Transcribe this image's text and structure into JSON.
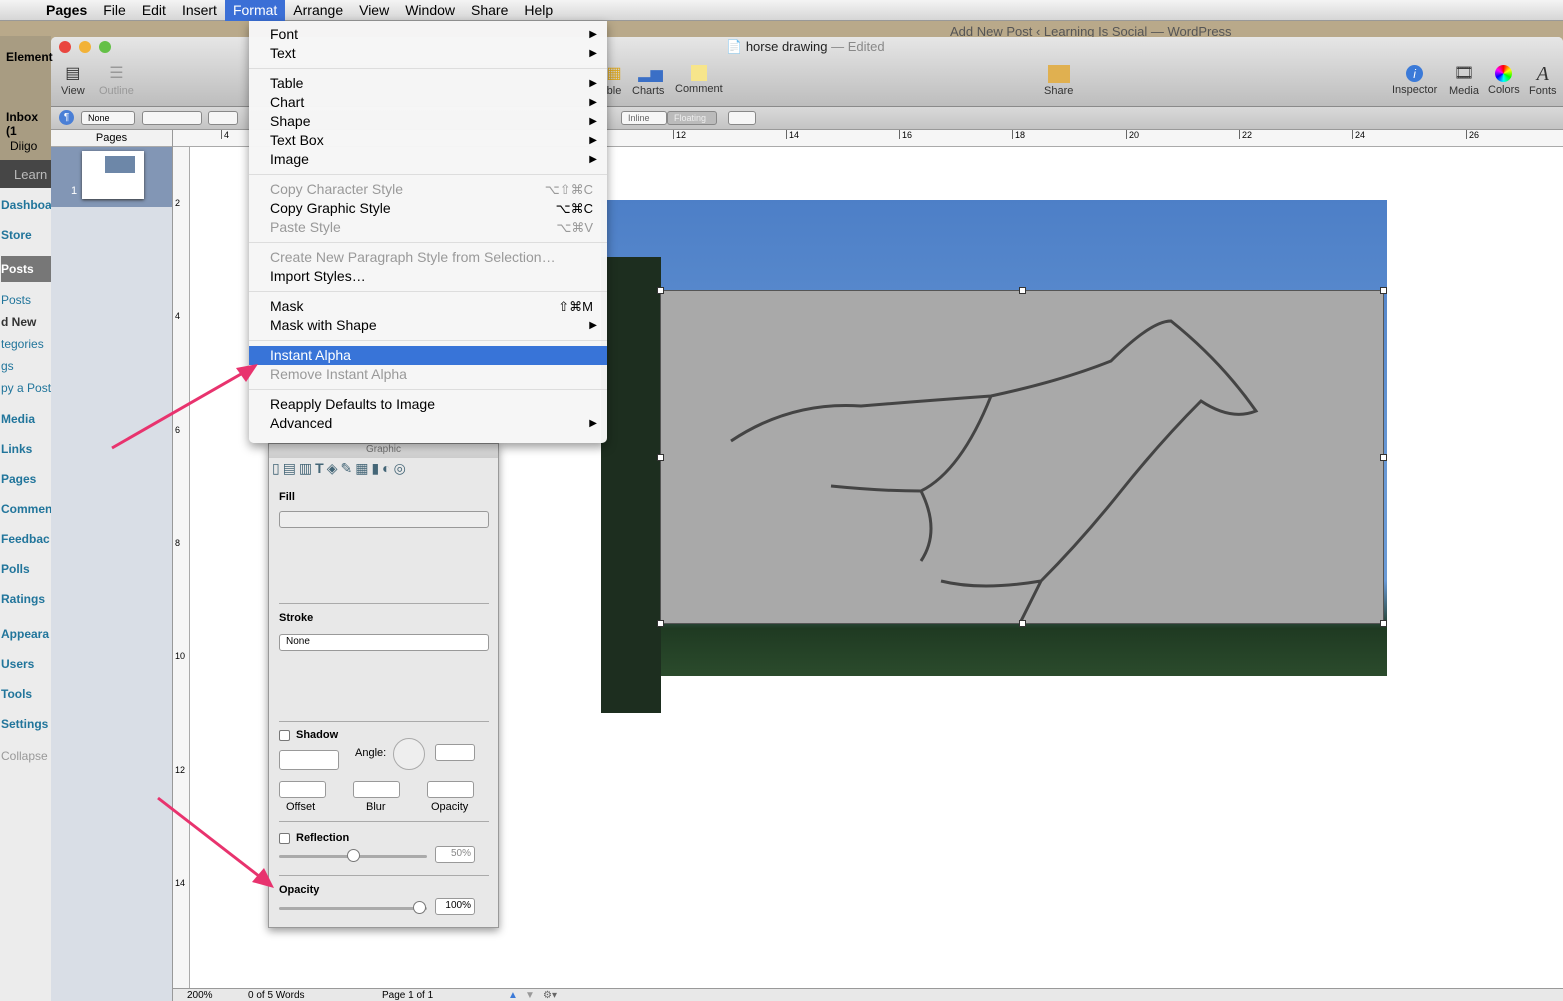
{
  "menubar": {
    "app": "Pages",
    "items": [
      "File",
      "Edit",
      "Insert",
      "Format",
      "Arrange",
      "View",
      "Window",
      "Share",
      "Help"
    ],
    "active": "Format"
  },
  "desktop": {
    "browser_title": "Add New Post ‹ Learning Is Social — WordPress",
    "bg_labels": [
      "Element",
      "Inbox (1",
      "Diigo",
      "Learn"
    ]
  },
  "wp_sidebar": {
    "items": [
      "Dashboa",
      "Store",
      "Posts",
      "Posts",
      "d New",
      "tegories",
      "gs",
      "py a Post",
      "Media",
      "Links",
      "Pages",
      "Commen",
      "Feedbac",
      "Polls",
      "Ratings",
      "Appeara",
      "Users",
      "Tools",
      "Settings",
      "Collapse"
    ]
  },
  "window": {
    "title": "horse drawing",
    "status": "— Edited"
  },
  "toolbar": {
    "left": [
      "View",
      "Outline"
    ],
    "middle": [
      "ble",
      "Charts",
      "Comment"
    ],
    "share": "Share",
    "right": [
      "Inspector",
      "Media",
      "Colors",
      "Fonts"
    ]
  },
  "formatbar": {
    "style": "None",
    "inline": "Inline",
    "floating": "Floating"
  },
  "pages_panel": {
    "header": "Pages",
    "page_number": "1"
  },
  "ruler": {
    "h": [
      "4",
      "12",
      "14",
      "16",
      "18",
      "20",
      "22",
      "24",
      "26"
    ],
    "v": [
      "2",
      "4",
      "6",
      "8",
      "10",
      "12",
      "14"
    ]
  },
  "format_menu": {
    "items": [
      {
        "label": "Font",
        "submenu": true
      },
      {
        "label": "Text",
        "submenu": true
      },
      {
        "sep": true
      },
      {
        "label": "Table",
        "submenu": true
      },
      {
        "label": "Chart",
        "submenu": true
      },
      {
        "label": "Shape",
        "submenu": true
      },
      {
        "label": "Text Box",
        "submenu": true
      },
      {
        "label": "Image",
        "submenu": true
      },
      {
        "sep": true
      },
      {
        "label": "Copy Character Style",
        "shortcut": "⌥⇧⌘C",
        "disabled": true
      },
      {
        "label": "Copy Graphic Style",
        "shortcut": "⌥⌘C"
      },
      {
        "label": "Paste Style",
        "shortcut": "⌥⌘V",
        "disabled": true
      },
      {
        "sep": true
      },
      {
        "label": "Create New Paragraph Style from Selection…",
        "disabled": true
      },
      {
        "label": "Import Styles…"
      },
      {
        "sep": true
      },
      {
        "label": "Mask",
        "shortcut": "⇧⌘M"
      },
      {
        "label": "Mask with Shape",
        "submenu": true
      },
      {
        "sep": true
      },
      {
        "label": "Instant Alpha",
        "selected": true
      },
      {
        "label": "Remove Instant Alpha",
        "disabled": true
      },
      {
        "sep": true
      },
      {
        "label": "Reapply Defaults to Image"
      },
      {
        "label": "Advanced",
        "submenu": true
      }
    ]
  },
  "inspector": {
    "title": "Graphic",
    "fill": "Fill",
    "stroke": "Stroke",
    "stroke_value": "None",
    "shadow": "Shadow",
    "angle": "Angle:",
    "offset": "Offset",
    "blur": "Blur",
    "opacity_small": "Opacity",
    "reflection": "Reflection",
    "reflection_value": "50%",
    "opacity": "Opacity",
    "opacity_value": "100%",
    "opacity_fraction": 1.0,
    "reflection_fraction": 0.5
  },
  "statusbar": {
    "zoom": "200%",
    "words": "0 of 5 Words",
    "page": "Page 1 of 1"
  },
  "colors": {
    "menu_highlight": "#3874d8",
    "arrow": "#e8336e",
    "wp_link": "#21759b"
  }
}
